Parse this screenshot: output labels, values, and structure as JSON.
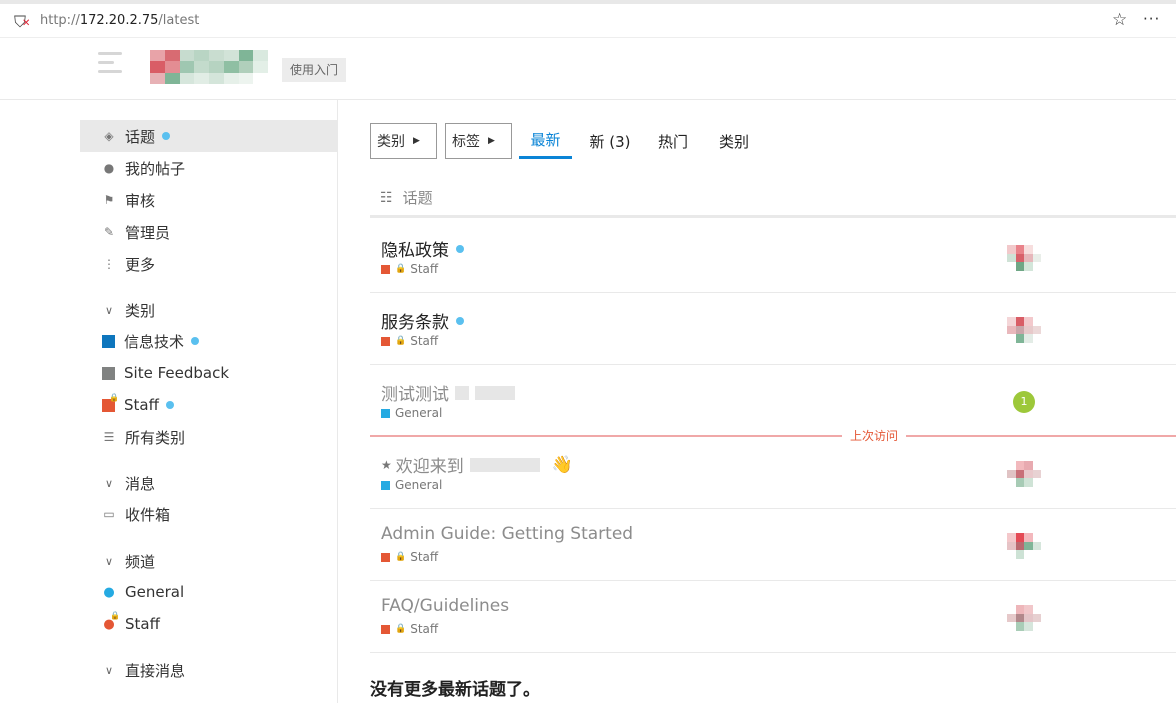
{
  "browser": {
    "url_prefix": "http://",
    "url_host": "172.20.2.75",
    "url_path": "/latest"
  },
  "header": {
    "getting_started": "使用入门"
  },
  "sidebar": {
    "items": [
      {
        "label": "话题",
        "icon": "layers-icon",
        "active": true,
        "unread": true
      },
      {
        "label": "我的帖子",
        "icon": "user-icon"
      },
      {
        "label": "审核",
        "icon": "flag-icon"
      },
      {
        "label": "管理员",
        "icon": "wrench-icon"
      },
      {
        "label": "更多",
        "icon": "ellipsis-vertical-icon"
      }
    ],
    "categories_section": "类别",
    "categories": [
      {
        "label": "信息技术",
        "color": "#0e76bd",
        "unread": true
      },
      {
        "label": "Site Feedback",
        "color": "#808281"
      },
      {
        "label": "Staff",
        "color": "#e45735",
        "locked": true,
        "unread": true
      },
      {
        "label": "所有类别",
        "icon": "list-icon"
      }
    ],
    "messages_section": "消息",
    "inbox": "收件箱",
    "channels_section": "频道",
    "channels": [
      {
        "label": "General",
        "color": "#25aae2"
      },
      {
        "label": "Staff",
        "color": "#e45735",
        "locked": true
      }
    ],
    "direct_section": "直接消息"
  },
  "nav": {
    "categories_dropdown": "类别",
    "tags_dropdown": "标签",
    "tabs": [
      "最新",
      "新 (3)",
      "热门",
      "类别"
    ],
    "active_tab": "最新"
  },
  "list": {
    "header": "话题",
    "topics": [
      {
        "title": "隐私政策",
        "category": "Staff",
        "cat_color": "#e45735",
        "locked": true,
        "unread": true
      },
      {
        "title": "服务条款",
        "category": "Staff",
        "cat_color": "#e45735",
        "locked": true,
        "unread": true
      },
      {
        "title": "测试测试",
        "category": "General",
        "cat_color": "#25aae2",
        "badge": "1"
      },
      {
        "title": "欢迎来到",
        "category": "General",
        "cat_color": "#25aae2",
        "pinned": true,
        "emoji": "👋"
      },
      {
        "title": "Admin Guide: Getting Started",
        "category": "Staff",
        "cat_color": "#e45735",
        "locked": true
      },
      {
        "title": "FAQ/Guidelines",
        "category": "Staff",
        "cat_color": "#e45735",
        "locked": true
      }
    ],
    "last_visit": "上次访问",
    "no_more": "没有更多最新话题了。"
  }
}
